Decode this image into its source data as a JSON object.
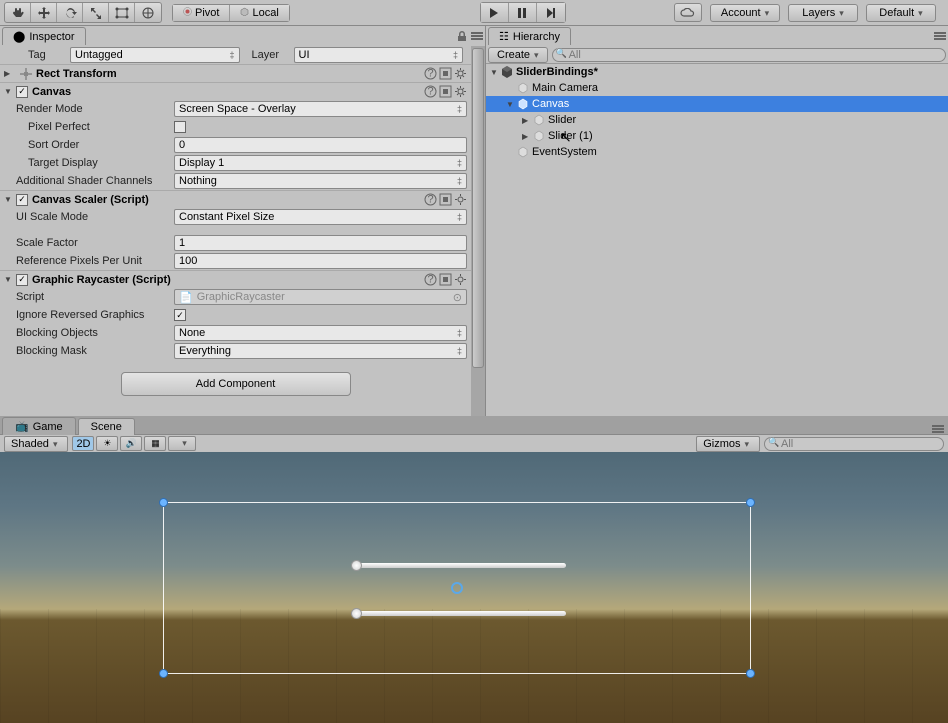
{
  "topbar": {
    "pivot_label": "Pivot",
    "local_label": "Local",
    "account_label": "Account",
    "layers_label": "Layers",
    "layout_label": "Default"
  },
  "inspector": {
    "title": "Inspector",
    "tag_label": "Tag",
    "tag_value": "Untagged",
    "layer_label": "Layer",
    "layer_value": "UI",
    "rect_transform": "Rect Transform",
    "canvas": {
      "title": "Canvas",
      "render_mode_label": "Render Mode",
      "render_mode_value": "Screen Space - Overlay",
      "pixel_perfect_label": "Pixel Perfect",
      "sort_order_label": "Sort Order",
      "sort_order_value": "0",
      "target_display_label": "Target Display",
      "target_display_value": "Display 1",
      "additional_channels_label": "Additional Shader Channels",
      "additional_channels_value": "Nothing"
    },
    "canvas_scaler": {
      "title": "Canvas Scaler (Script)",
      "ui_scale_mode_label": "UI Scale Mode",
      "ui_scale_mode_value": "Constant Pixel Size",
      "scale_factor_label": "Scale Factor",
      "scale_factor_value": "1",
      "ref_pixels_label": "Reference Pixels Per Unit",
      "ref_pixels_value": "100"
    },
    "graphic_raycaster": {
      "title": "Graphic Raycaster (Script)",
      "script_label": "Script",
      "script_value": "GraphicRaycaster",
      "ignore_reversed_label": "Ignore Reversed Graphics",
      "blocking_objects_label": "Blocking Objects",
      "blocking_objects_value": "None",
      "blocking_mask_label": "Blocking Mask",
      "blocking_mask_value": "Everything"
    },
    "add_component": "Add Component"
  },
  "hierarchy": {
    "title": "Hierarchy",
    "create_label": "Create",
    "search_placeholder": "All",
    "scene_name": "SliderBindings*",
    "items": [
      {
        "name": "Main Camera",
        "depth": 1
      },
      {
        "name": "Canvas",
        "depth": 1,
        "selected": true,
        "arrow": "open"
      },
      {
        "name": "Slider",
        "depth": 2,
        "arrow": "closed"
      },
      {
        "name": "Slider (1)",
        "depth": 2,
        "arrow": "closed"
      },
      {
        "name": "EventSystem",
        "depth": 1
      }
    ]
  },
  "scene": {
    "game_tab": "Game",
    "scene_tab": "Scene",
    "shaded_label": "Shaded",
    "twod_label": "2D",
    "gizmos_label": "Gizmos",
    "search_placeholder": "All"
  }
}
